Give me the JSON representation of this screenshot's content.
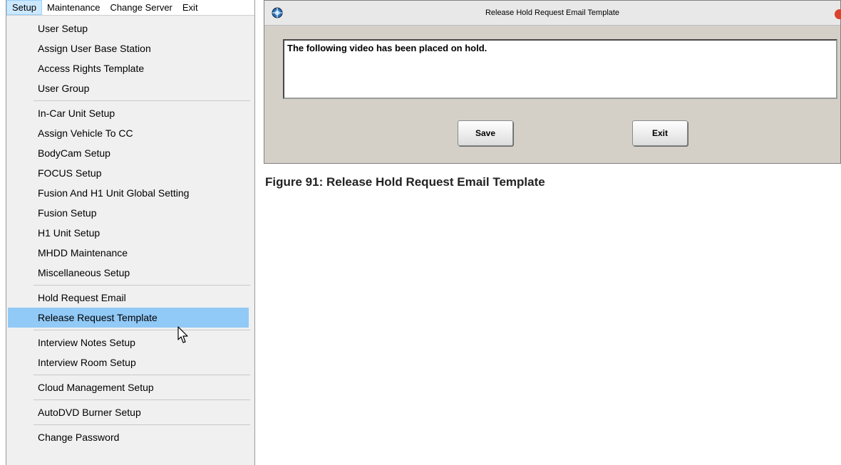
{
  "menubar": {
    "items": [
      "Setup",
      "Maintenance",
      "Change Server",
      "Exit"
    ]
  },
  "dropdown": {
    "groups": [
      [
        "User Setup",
        "Assign User Base Station",
        "Access Rights Template",
        "User Group"
      ],
      [
        "In-Car Unit Setup",
        "Assign Vehicle To CC",
        "BodyCam Setup",
        "FOCUS Setup",
        "Fusion And H1 Unit Global Setting",
        "Fusion Setup",
        "H1 Unit Setup",
        "MHDD Maintenance",
        "Miscellaneous Setup"
      ],
      [
        "Hold Request Email",
        "Release Request Template"
      ],
      [
        "Interview Notes Setup",
        "Interview Room Setup"
      ],
      [
        "Cloud Management Setup"
      ],
      [
        "AutoDVD Burner Setup"
      ],
      [
        "Change Password"
      ]
    ],
    "highlighted": "Release Request Template"
  },
  "dialog": {
    "title": "Release Hold Request Email Template",
    "body_text": "The following video has been placed on hold.",
    "save_label": "Save",
    "exit_label": "Exit"
  },
  "caption": "Figure 91: Release Hold Request Email Template",
  "colors": {
    "highlight": "#91c9f7",
    "menu_active": "#cce8ff",
    "dialog_bg": "#d4d0c8"
  }
}
